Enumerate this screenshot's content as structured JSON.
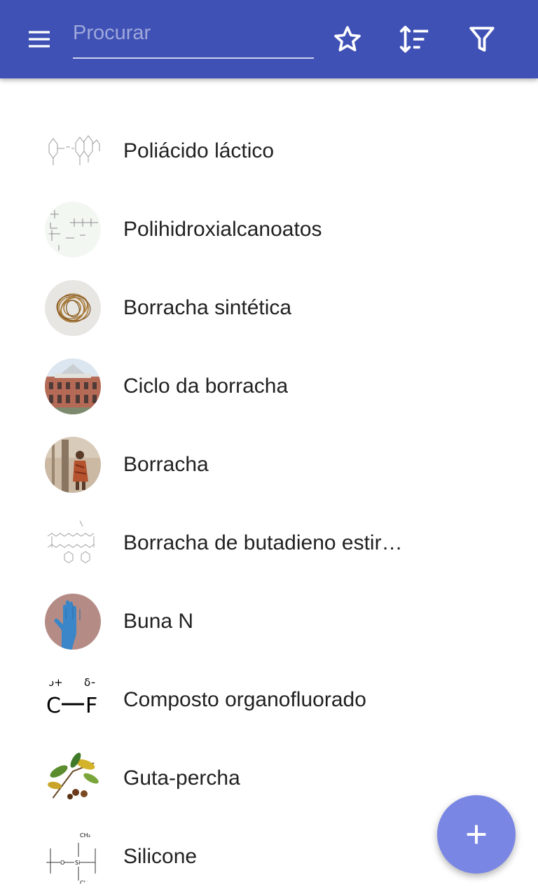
{
  "toolbar": {
    "menu_icon": "menu-icon",
    "search_placeholder": "Procurar",
    "favorites_icon": "star-outline-icon",
    "sort_icon": "sort-icon",
    "filter_icon": "filter-icon",
    "background_color": "#3f51b5"
  },
  "items": [
    {
      "label": "Poliácido láctico",
      "thumb": "chemical-structure"
    },
    {
      "label": "Polihidroxialcanoatos",
      "thumb": "chemical-structure"
    },
    {
      "label": "Borracha sintética",
      "thumb": "rubber-bands-photo"
    },
    {
      "label": "Ciclo da borracha",
      "thumb": "building-photo"
    },
    {
      "label": "Borracha",
      "thumb": "rubber-tapping-photo"
    },
    {
      "label": "Borracha de butadieno estir…",
      "thumb": "chemical-structure"
    },
    {
      "label": "Buna N",
      "thumb": "blue-glove-photo"
    },
    {
      "label": "Composto organofluorado",
      "thumb": "c-f-bond-diagram"
    },
    {
      "label": "Guta-percha",
      "thumb": "botanical-illustration"
    },
    {
      "label": "Silicone",
      "thumb": "chemical-structure"
    }
  ],
  "thumb_texts": {
    "cf_delta_plus": "δ+",
    "cf_delta_minus": "δ−",
    "cf_c": "C",
    "cf_f": "F",
    "si_ch3": "CH₃",
    "si_o": "O",
    "si_si": "Si"
  },
  "fab": {
    "icon": "plus-icon",
    "color": "#7986e3"
  }
}
